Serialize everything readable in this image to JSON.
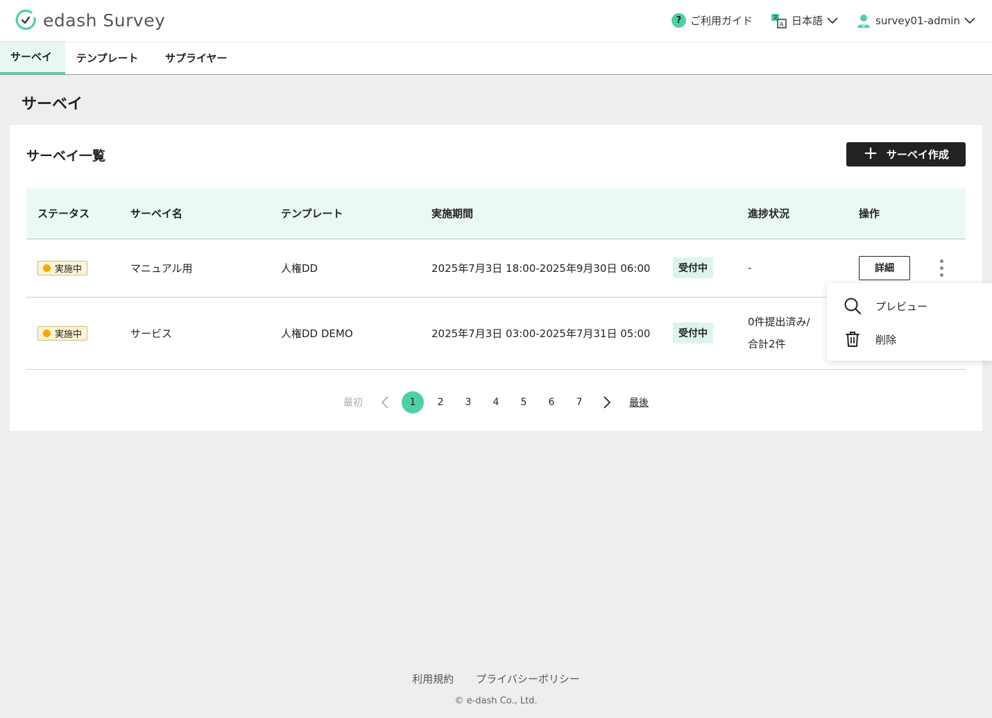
{
  "brand": {
    "logo_text_main": "edash",
    "logo_text_sub": "Survey"
  },
  "header": {
    "guide": "ご利用ガイド",
    "language": "日本語",
    "user": "survey01-admin"
  },
  "tabs": [
    {
      "label": "サーベイ"
    },
    {
      "label": "テンプレート"
    },
    {
      "label": "サプライヤー"
    }
  ],
  "page_title": "サーベイ",
  "card": {
    "title": "サーベイ一覧",
    "create_button": "サーベイ作成"
  },
  "table": {
    "headers": {
      "status": "ステータス",
      "name": "サーベイ名",
      "template": "テンプレート",
      "period": "実施期間",
      "progress": "進捗状況",
      "actions": "操作"
    },
    "rows": [
      {
        "status": "実施中",
        "name": "マニュアル用",
        "template": "人権DD",
        "period": "2025年7月3日 18:00-2025年9月30日 06:00",
        "reception": "受付中",
        "progress_line1": "-",
        "progress_line2": "",
        "detail": "詳細"
      },
      {
        "status": "実施中",
        "name": "サービス",
        "template": "人権DD DEMO",
        "period": "2025年7月3日 03:00-2025年7月31日 05:00",
        "reception": "受付中",
        "progress_line1": "0件提出済み/",
        "progress_line2": "合計2件",
        "detail": ""
      }
    ]
  },
  "pagination": {
    "first": "最初",
    "last": "最後",
    "pages": [
      "1",
      "2",
      "3",
      "4",
      "5",
      "6",
      "7"
    ],
    "current": "1"
  },
  "popup_menu": {
    "preview": "プレビュー",
    "delete": "削除"
  },
  "footer": {
    "terms": "利用規約",
    "privacy": "プライバシーポリシー",
    "copyright": "© e-dash Co., Ltd."
  },
  "colors": {
    "accent": "#4fcfa5",
    "dark": "#222222",
    "status_dot": "#f5a800"
  }
}
